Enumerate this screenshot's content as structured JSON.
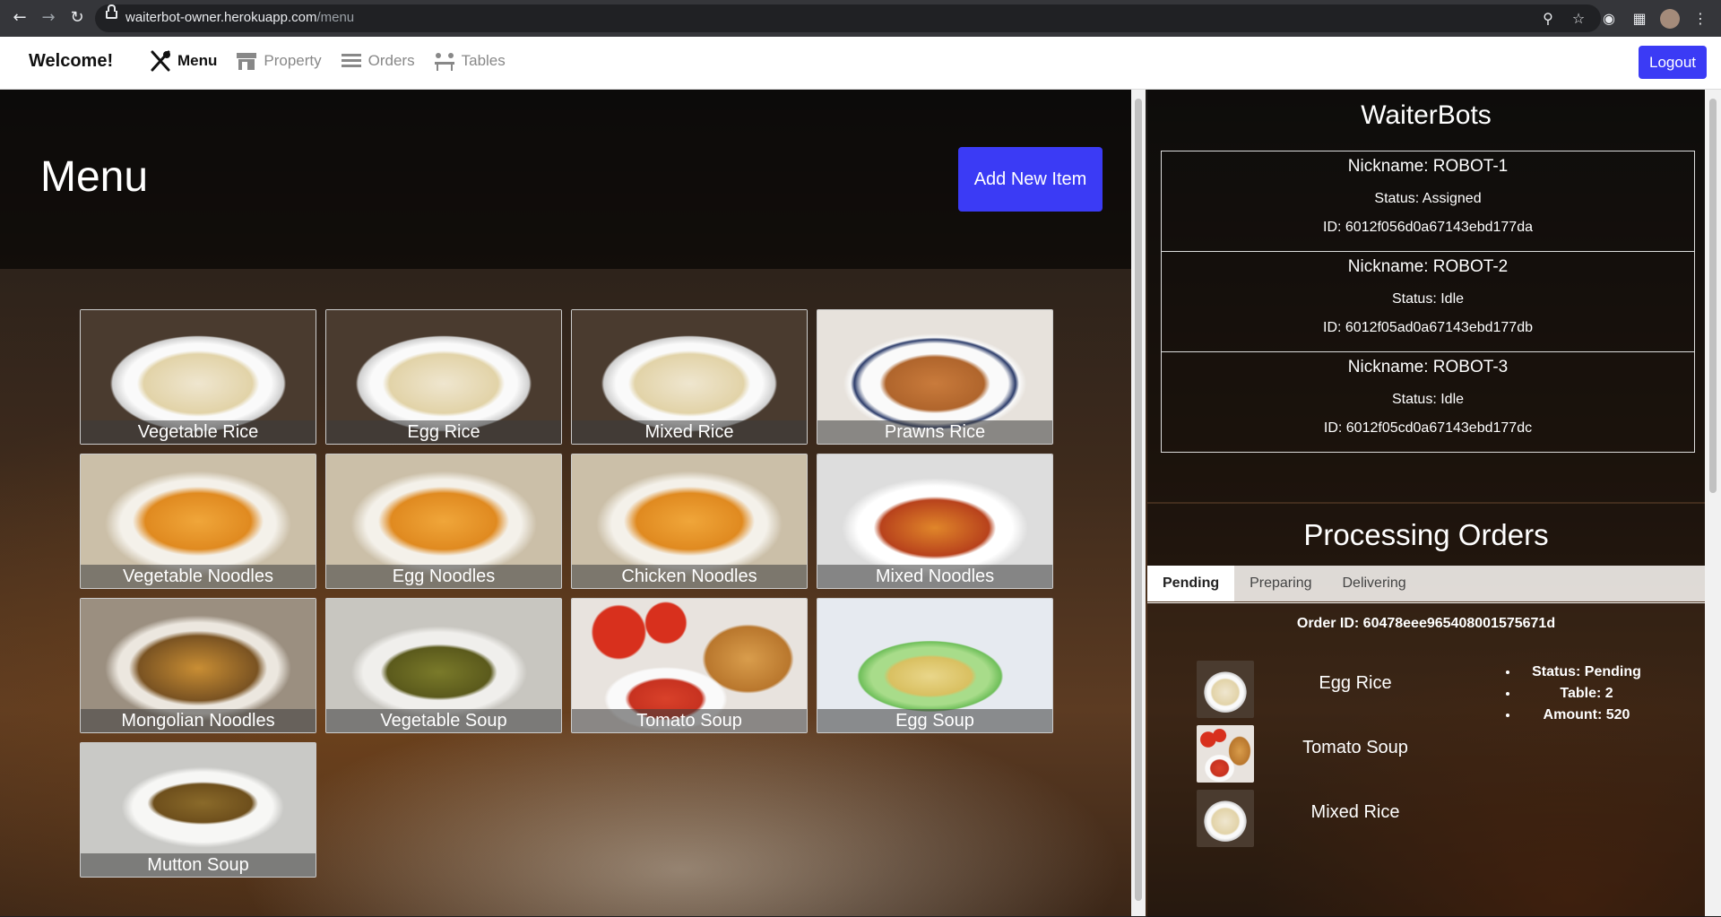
{
  "browser": {
    "url_host": "waiterbot-owner.herokuapp.com",
    "url_path": "/menu"
  },
  "navbar": {
    "brand": "Welcome!",
    "links": [
      {
        "label": "Menu",
        "active": true,
        "icon": "utensils-icon"
      },
      {
        "label": "Property",
        "active": false,
        "icon": "store-icon"
      },
      {
        "label": "Orders",
        "active": false,
        "icon": "list-icon"
      },
      {
        "label": "Tables",
        "active": false,
        "icon": "tables-icon"
      }
    ],
    "logout_label": "Logout"
  },
  "menu": {
    "title": "Menu",
    "add_label": "Add New Item",
    "items": [
      {
        "name": "Vegetable Rice",
        "dish": "rice"
      },
      {
        "name": "Egg Rice",
        "dish": "rice"
      },
      {
        "name": "Mixed Rice",
        "dish": "rice"
      },
      {
        "name": "Prawns Rice",
        "dish": "prawn-rice"
      },
      {
        "name": "Vegetable Noodles",
        "dish": "noodles"
      },
      {
        "name": "Egg Noodles",
        "dish": "noodles"
      },
      {
        "name": "Chicken Noodles",
        "dish": "noodles"
      },
      {
        "name": "Mixed Noodles",
        "dish": "noodles-red"
      },
      {
        "name": "Mongolian Noodles",
        "dish": "noodles-dark"
      },
      {
        "name": "Vegetable Soup",
        "dish": "soup-green"
      },
      {
        "name": "Tomato Soup",
        "dish": "soup-red"
      },
      {
        "name": "Egg Soup",
        "dish": "soup-yellow"
      },
      {
        "name": "Mutton Soup",
        "dish": "soup-brown"
      }
    ]
  },
  "waiterbots": {
    "title": "WaiterBots",
    "bots": [
      {
        "nickname": "Nickname: ROBOT-1",
        "status": "Status: Assigned",
        "id": "ID: 6012f056d0a67143ebd177da"
      },
      {
        "nickname": "Nickname: ROBOT-2",
        "status": "Status: Idle",
        "id": "ID: 6012f05ad0a67143ebd177db"
      },
      {
        "nickname": "Nickname: ROBOT-3",
        "status": "Status: Idle",
        "id": "ID: 6012f05cd0a67143ebd177dc"
      }
    ]
  },
  "orders": {
    "title": "Processing Orders",
    "tabs": [
      {
        "label": "Pending",
        "active": true
      },
      {
        "label": "Preparing",
        "active": false
      },
      {
        "label": "Delivering",
        "active": false
      }
    ],
    "current": {
      "order_id": "Order ID: 60478eee965408001575671d",
      "items": [
        {
          "name": "Egg Rice",
          "dish": "rice"
        },
        {
          "name": "Tomato Soup",
          "dish": "soup-red"
        },
        {
          "name": "Mixed Rice",
          "dish": "rice"
        }
      ],
      "status": "Status: Pending",
      "table": "Table: 2",
      "amount": "Amount: 520"
    }
  },
  "colors": {
    "accent": "#3b3bf5"
  }
}
